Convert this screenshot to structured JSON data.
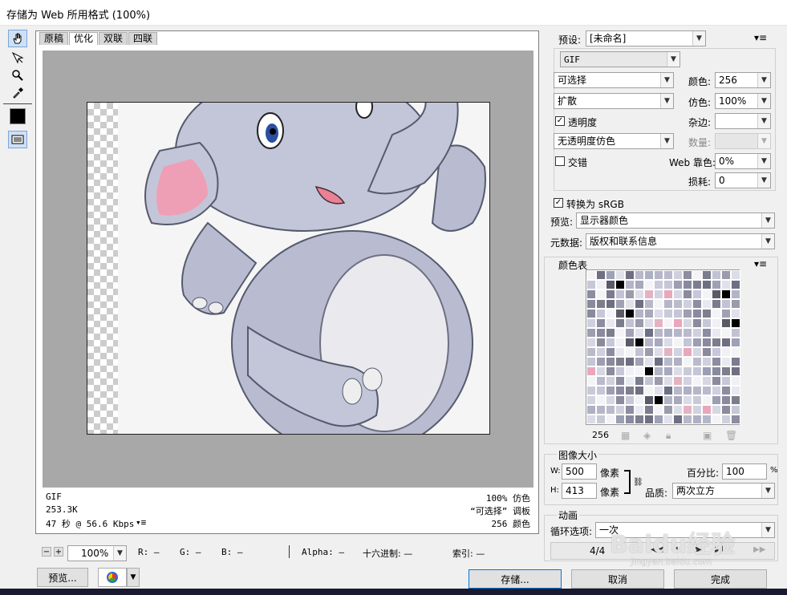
{
  "window": {
    "title": "存储为 Web 所用格式 (100%)"
  },
  "tabs": [
    "原稿",
    "优化",
    "双联",
    "四联"
  ],
  "info_left": [
    "GIF",
    "253.3K",
    "47 秒 @ 56.6 Kbps"
  ],
  "info_right": [
    "100% 仿色",
    "“可选择” 调板",
    "256 颜色"
  ],
  "info_menu_icon": "menu-icon",
  "statusbar": {
    "zoom": "100%",
    "r": "R: —",
    "g": "G: —",
    "b": "B: —",
    "alpha": "Alpha: —",
    "hex": "十六进制: —",
    "index": "索引: —"
  },
  "settings": {
    "preset_label": "预设:",
    "preset_value": "[未命名]",
    "format": "GIF",
    "reduction": "可选择",
    "dither_algo": "扩散",
    "transparency_label": "透明度",
    "transparency_checked": true,
    "transparency_dither": "无透明度仿色",
    "interlace_label": "交错",
    "interlace_checked": false,
    "colors_label": "颜色:",
    "colors_value": "256",
    "dither_label": "仿色:",
    "dither_value": "100%",
    "matte_label": "杂边:",
    "matte_value": "",
    "amount_label": "数量:",
    "amount_value": "",
    "websnap_label": "Web 靠色:",
    "websnap_value": "0%",
    "lossy_label": "损耗:",
    "lossy_value": "0",
    "srgb_label": "转换为 sRGB",
    "srgb_checked": true,
    "preview_label": "预览:",
    "preview_value": "显示器颜色",
    "metadata_label": "元数据:",
    "metadata_value": "版权和联系信息"
  },
  "color_table": {
    "title": "颜色表",
    "count": "256",
    "colors": [
      "#7d7e8c",
      "#5a5b66",
      "#9a9bab",
      "#b7b8c8",
      "#c9cad8",
      "#d6d7e3",
      "#8c8da0",
      "#6e6f80",
      "#000000",
      "#dcdde8",
      "#aeb0c4",
      "#c4c5d6",
      "#8a8b9c",
      "#e8e9f0",
      "#9fa1b5",
      "#b3b4c6",
      "#e3b3c2",
      "#b5b7c9",
      "#9c9eb2",
      "#c6c7d8",
      "#7b7c8e",
      "#e0e1ea",
      "#a7a9bc",
      "#d2d3e0",
      "#b9bbcc",
      "#888a9d",
      "#f0f0f5",
      "#c1c2d3",
      "#6d6f82",
      "#dadbe6",
      "#e9a7bb",
      "#cfd0dd"
    ],
    "footer_icons": [
      "map-icon",
      "cube-icon",
      "lock-icon",
      "new-color-icon",
      "trash-icon"
    ]
  },
  "image_size": {
    "title": "图像大小",
    "w_label": "W:",
    "w_value": "500",
    "h_label": "H:",
    "h_value": "413",
    "unit": "像素",
    "percent_label": "百分比:",
    "percent_value": "100",
    "percent_unit": "%",
    "quality_label": "品质:",
    "quality_value": "两次立方"
  },
  "animation": {
    "title": "动画",
    "loop_label": "循环选项:",
    "loop_value": "一次",
    "frame": "4/4"
  },
  "buttons": {
    "preview": "预览...",
    "save": "存储...",
    "cancel": "取消",
    "done": "完成"
  },
  "watermark": {
    "text": "Baidu经验",
    "url": "jingyan.baidu.com"
  },
  "colors": {
    "accent": "#0078d7",
    "canvas_bg": "#a8a8a8"
  }
}
